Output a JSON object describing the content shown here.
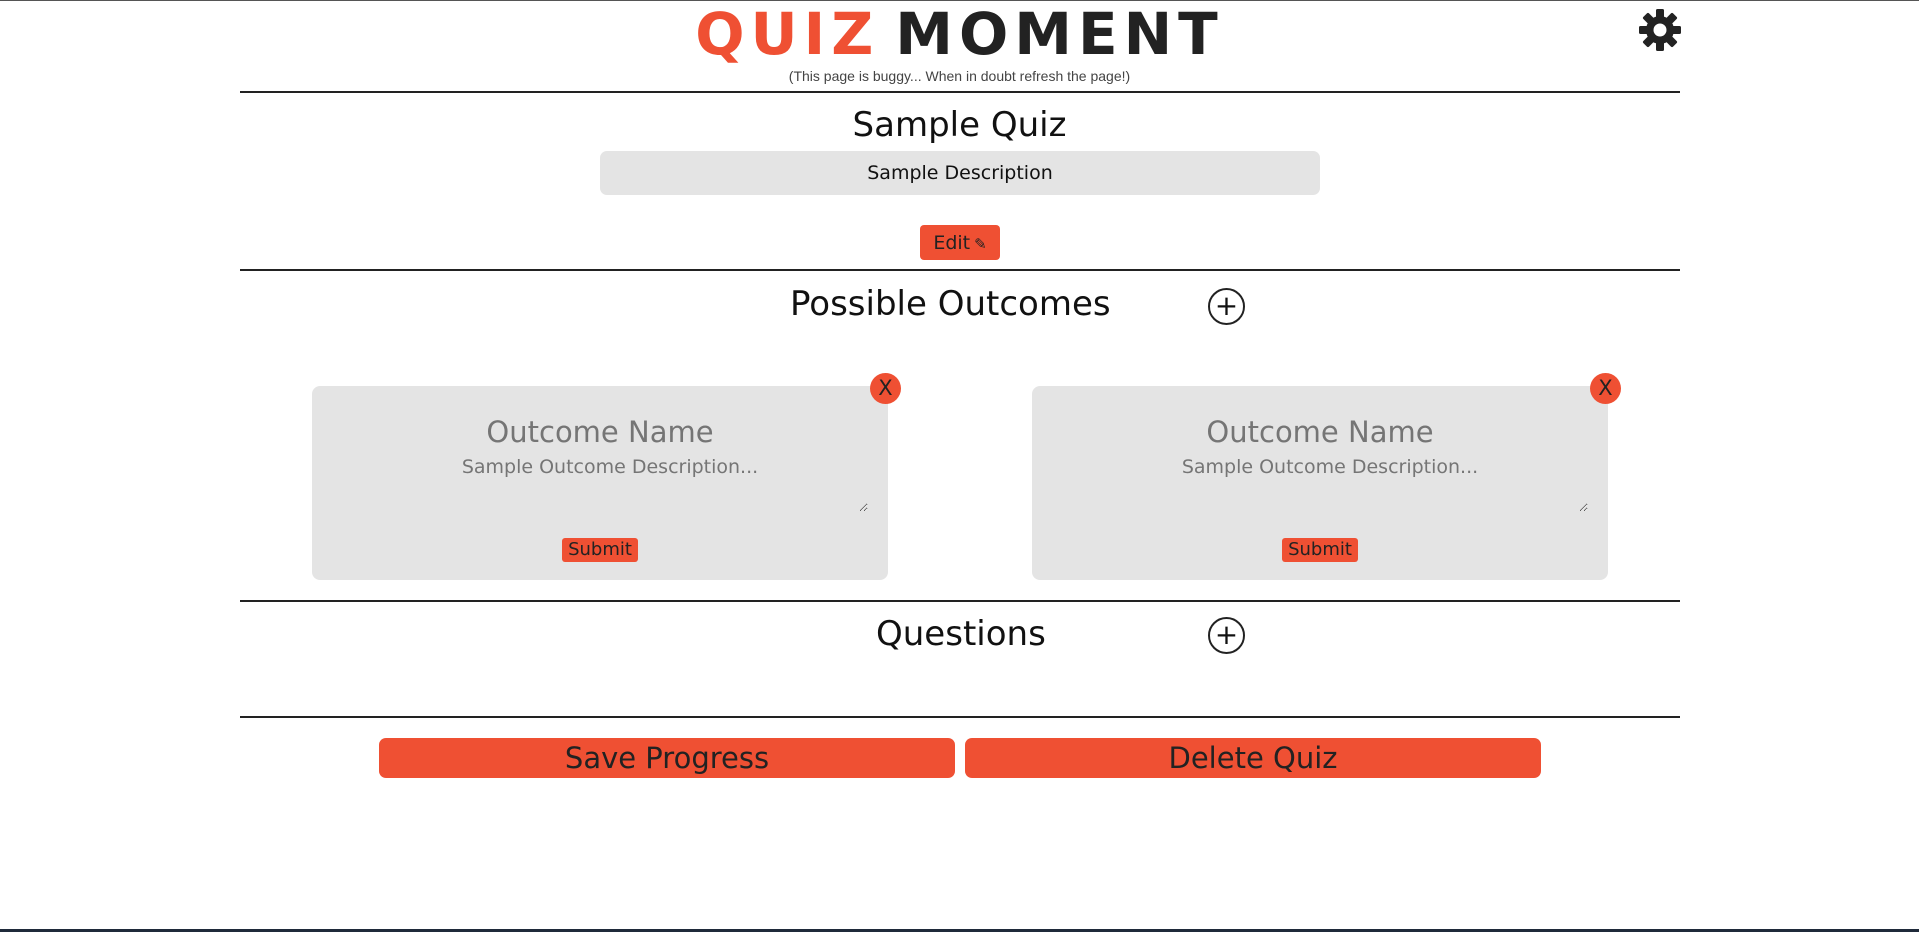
{
  "header": {
    "logo_part1": "QUIZ",
    "logo_part2": "MOMENT",
    "subtitle": "(This page is buggy... When in doubt refresh the page!)",
    "settings_icon": "gear-icon"
  },
  "quiz": {
    "title": "Sample Quiz",
    "description": "Sample Description",
    "edit_label": "Edit",
    "edit_icon": "✎"
  },
  "outcomes": {
    "title": "Possible Outcomes",
    "add_label": "+",
    "cards": [
      {
        "close_label": "X",
        "name_placeholder": "Outcome Name",
        "description_placeholder": "Sample Outcome Description...",
        "submit_label": "Submit"
      },
      {
        "close_label": "X",
        "name_placeholder": "Outcome Name",
        "description_placeholder": "Sample Outcome Description...",
        "submit_label": "Submit"
      }
    ]
  },
  "questions": {
    "title": "Questions",
    "add_label": "+"
  },
  "actions": {
    "save_label": "Save Progress",
    "delete_label": "Delete Quiz"
  },
  "colors": {
    "accent": "#ef5033",
    "panel": "#e4e4e4",
    "text": "#222222"
  }
}
